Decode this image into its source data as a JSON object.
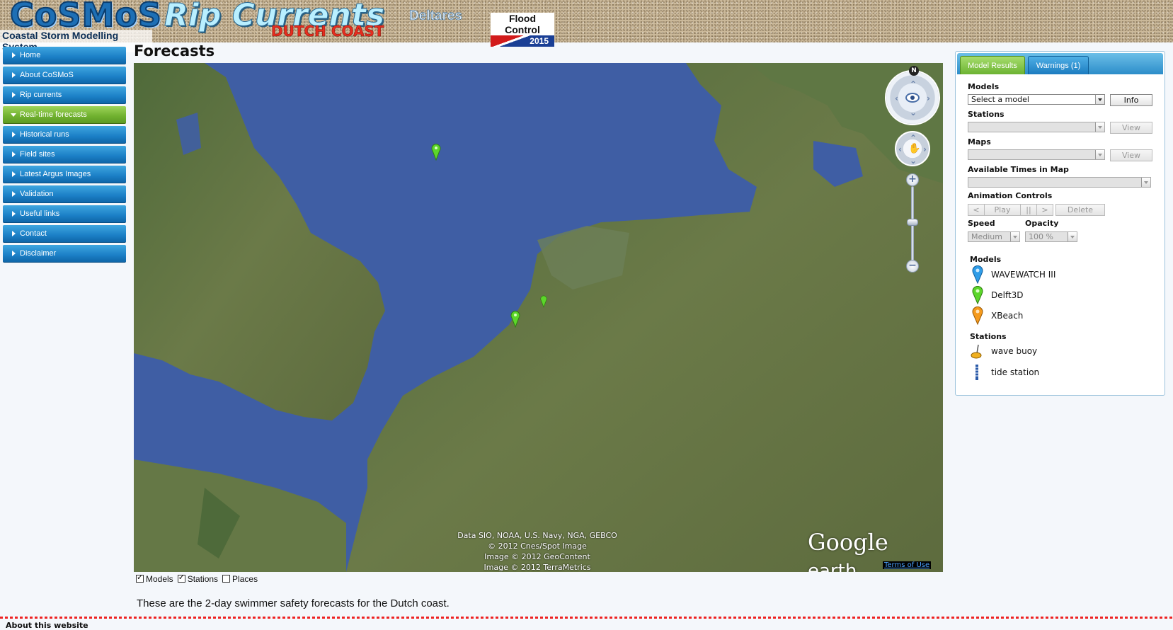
{
  "header": {
    "logo_main": "CoSMoS",
    "logo_sub": "Coastal Storm Modelling System",
    "title": "Rip Currents",
    "subtitle": "DUTCH COAST",
    "partner1": "Deltares",
    "partner2_top": "Flood Control",
    "partner2_year": "2015"
  },
  "sidebar": {
    "items": [
      {
        "label": "Home",
        "active": false
      },
      {
        "label": "About CoSMoS",
        "active": false
      },
      {
        "label": "Rip currents",
        "active": false
      },
      {
        "label": "Real-time forecasts",
        "active": true
      },
      {
        "label": "Historical runs",
        "active": false
      },
      {
        "label": "Field sites",
        "active": false
      },
      {
        "label": "Latest Argus Images",
        "active": false
      },
      {
        "label": "Validation",
        "active": false
      },
      {
        "label": "Useful links",
        "active": false
      },
      {
        "label": "Contact",
        "active": false
      },
      {
        "label": "Disclaimer",
        "active": false
      }
    ]
  },
  "main": {
    "page_title": "Forecasts",
    "map": {
      "compass_label": "N",
      "attribution": [
        "Data SIO, NOAA, U.S. Navy, NGA, GEBCO",
        "© 2012 Cnes/Spot Image",
        "Image © 2012 GeoContent",
        "Image © 2012 TerraMetrics"
      ],
      "logo_google": "Google",
      "logo_earth": "earth",
      "terms_label": "Terms of Use",
      "marker_color": "#5cd62a"
    },
    "layers": [
      {
        "label": "Models",
        "checked": true
      },
      {
        "label": "Stations",
        "checked": true
      },
      {
        "label": "Places",
        "checked": false
      }
    ],
    "intro": "These are the 2-day swimmer safety forecasts for the Dutch coast."
  },
  "panel": {
    "tabs": [
      {
        "label": "Model Results",
        "active": true
      },
      {
        "label": "Warnings (1)",
        "active": false
      }
    ],
    "models_label": "Models",
    "models_select": "Select a model",
    "info_button": "Info",
    "stations_label": "Stations",
    "view_button": "View",
    "maps_label": "Maps",
    "times_label": "Available Times in Map",
    "animation_label": "Animation Controls",
    "anim_prev": "<",
    "anim_play": "Play",
    "anim_pause": "||",
    "anim_next": ">",
    "anim_delete": "Delete",
    "speed_label": "Speed",
    "speed_value": "Medium",
    "opacity_label": "Opacity",
    "opacity_value": "100 %",
    "legend_models_title": "Models",
    "legend_models": [
      {
        "label": "WAVEWATCH III",
        "color": "#2f9de8"
      },
      {
        "label": "Delft3D",
        "color": "#5cd62a"
      },
      {
        "label": "XBeach",
        "color": "#f59a1c"
      }
    ],
    "legend_stations_title": "Stations",
    "legend_stations": [
      {
        "label": "wave buoy",
        "icon": "wave-buoy-icon"
      },
      {
        "label": "tide station",
        "icon": "tide-station-icon"
      }
    ]
  },
  "footer": {
    "title": "About this website"
  }
}
